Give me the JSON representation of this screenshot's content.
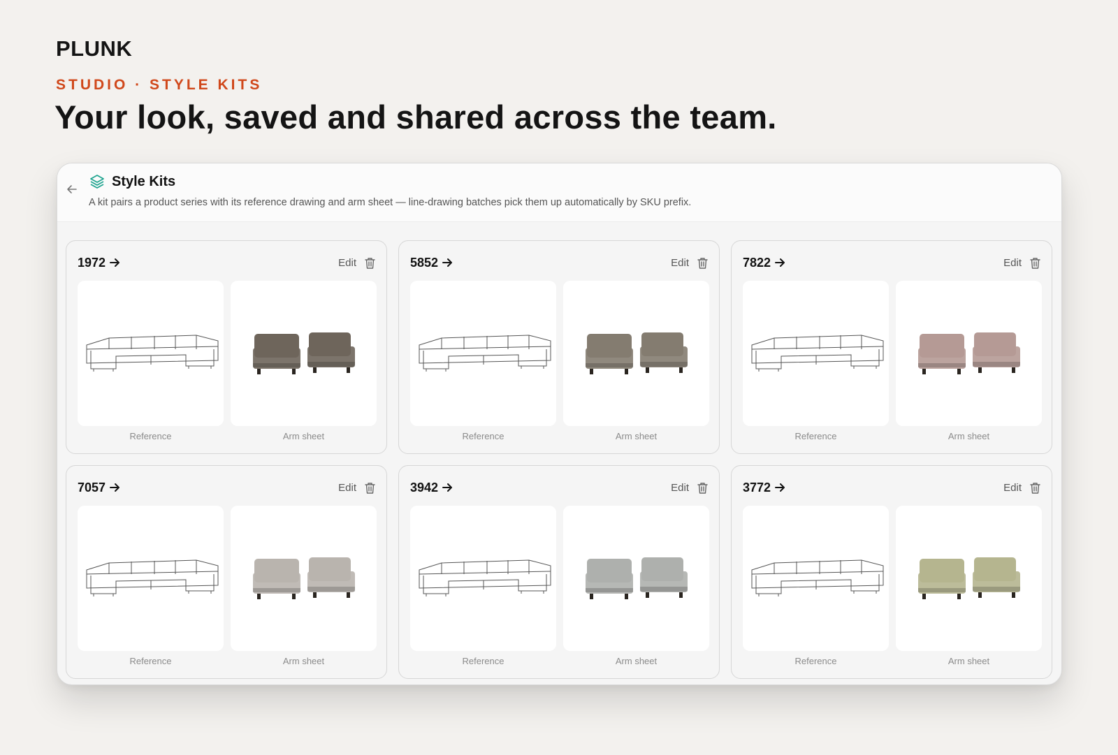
{
  "brand": "PLUNK",
  "eyebrow": "STUDIO · STYLE KITS",
  "headline": "Your look, saved and shared across the team.",
  "window": {
    "title": "Style Kits",
    "description": "A kit pairs a product series with its reference drawing and arm sheet — line-drawing batches pick them up automatically by SKU prefix.",
    "accent_color": "#1fa48f"
  },
  "card_labels": {
    "edit": "Edit",
    "reference": "Reference",
    "arm_sheet": "Arm sheet"
  },
  "kits": [
    {
      "sku": "1972",
      "fabric_color": "#6e655b"
    },
    {
      "sku": "5852",
      "fabric_color": "#847c70"
    },
    {
      "sku": "7822",
      "fabric_color": "#b59a95"
    },
    {
      "sku": "7057",
      "fabric_color": "#b9b4ae"
    },
    {
      "sku": "3942",
      "fabric_color": "#aeb0ad"
    },
    {
      "sku": "3772",
      "fabric_color": "#b5b58f"
    }
  ],
  "colors": {
    "eyebrow": "#d0481b",
    "background": "#f3f1ee"
  }
}
